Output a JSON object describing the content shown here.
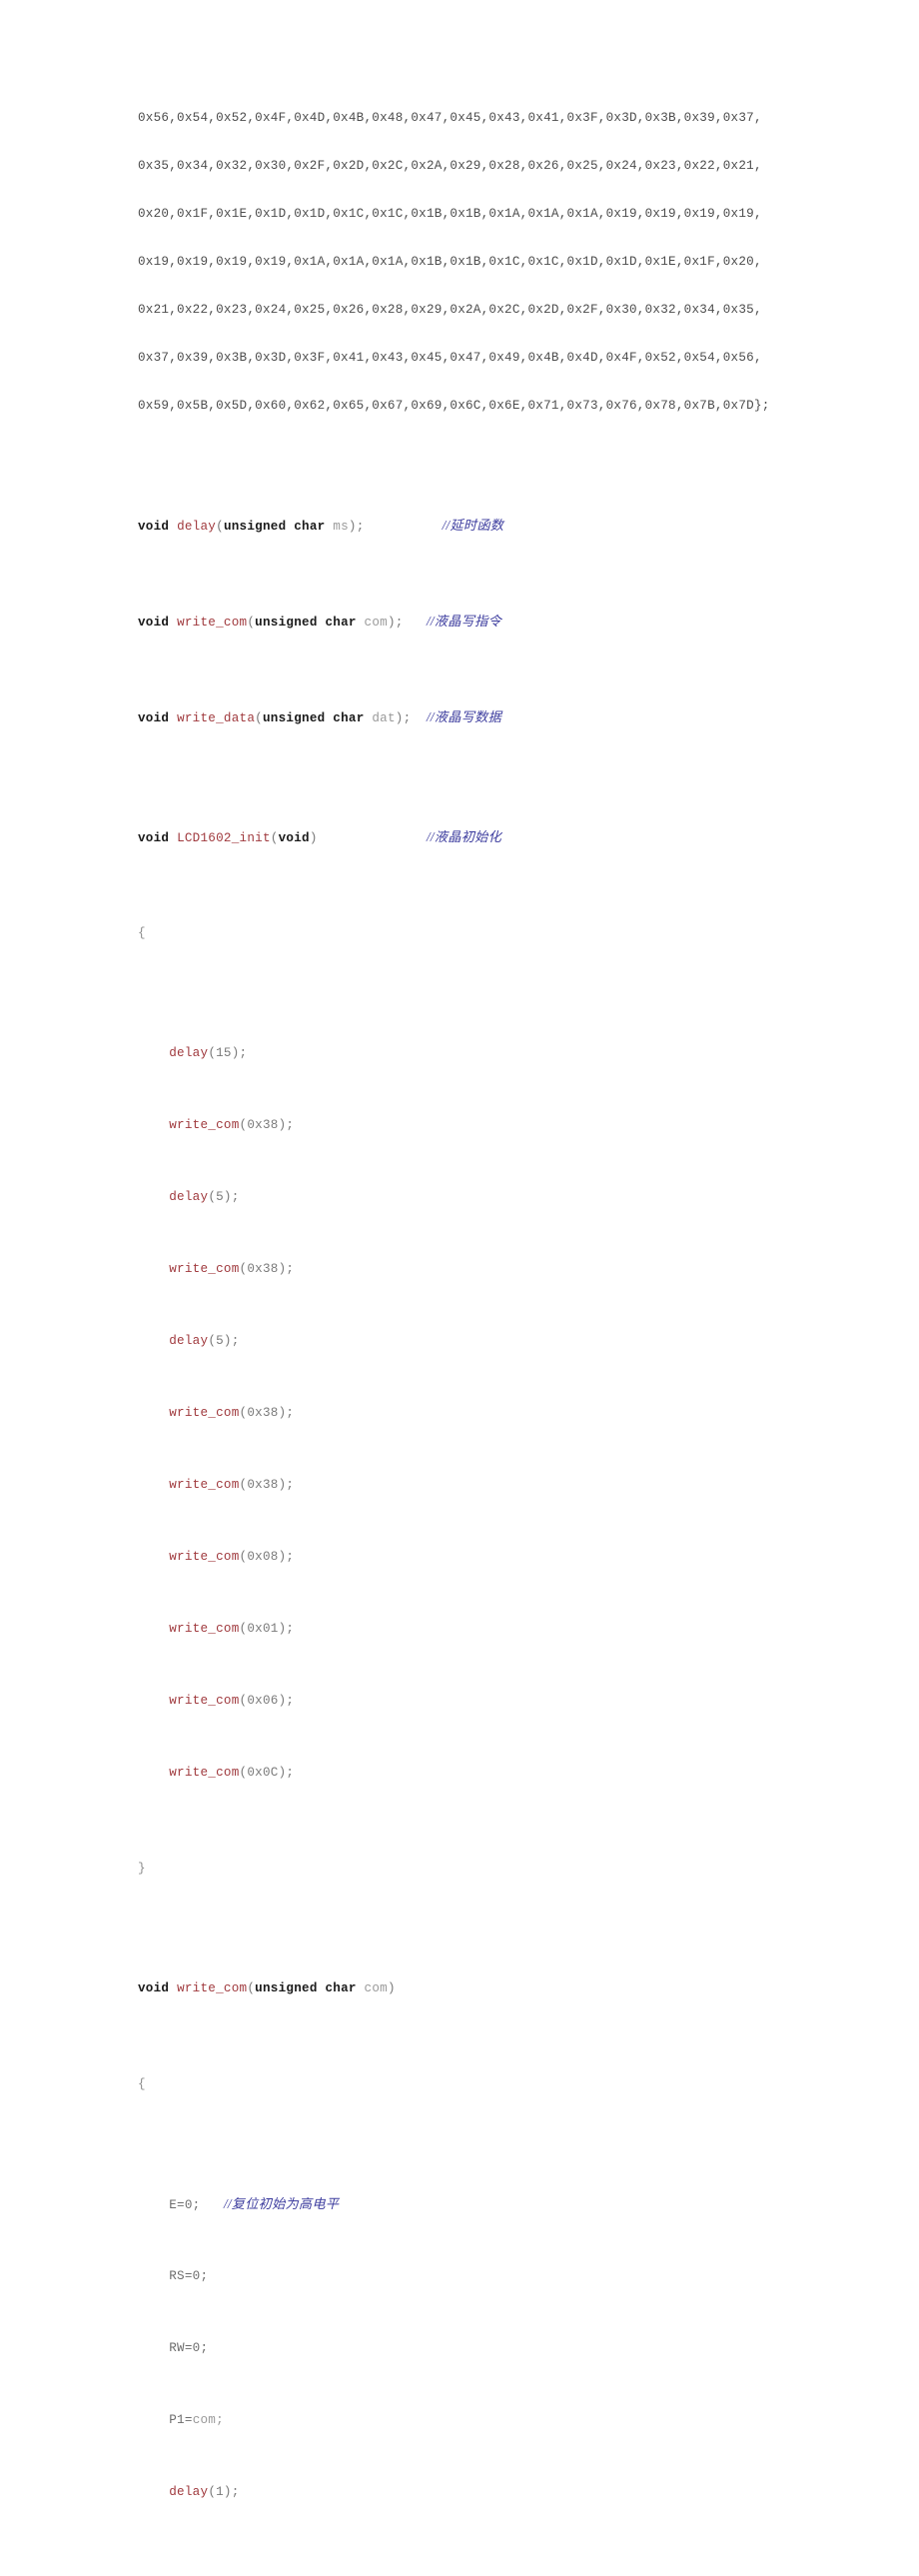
{
  "document": {
    "type": "source-code-listing",
    "language": "C",
    "page_background": "#ffffff",
    "colors": {
      "plain_text": "#4d4d4d",
      "keyword": "#1a1a1a",
      "function_name": "#a03a3e",
      "variable": "#9a9a9a",
      "punctuation": "#7a7a7a",
      "comment": "#3c3c9e"
    }
  },
  "hex_paragraphs": [
    "0x56,0x54,0x52,0x4F,0x4D,0x4B,0x48,0x47,0x45,0x43,0x41,0x3F,0x3D,0x3B,0x39,0x37,",
    "0x35,0x34,0x32,0x30,0x2F,0x2D,0x2C,0x2A,0x29,0x28,0x26,0x25,0x24,0x23,0x22,0x21,",
    "0x20,0x1F,0x1E,0x1D,0x1D,0x1C,0x1C,0x1B,0x1B,0x1A,0x1A,0x1A,0x19,0x19,0x19,0x19,",
    "0x19,0x19,0x19,0x19,0x1A,0x1A,0x1A,0x1B,0x1B,0x1C,0x1C,0x1D,0x1D,0x1E,0x1F,0x20,",
    "0x21,0x22,0x23,0x24,0x25,0x26,0x28,0x29,0x2A,0x2C,0x2D,0x2F,0x30,0x32,0x34,0x35,",
    "0x37,0x39,0x3B,0x3D,0x3F,0x41,0x43,0x45,0x47,0x49,0x4B,0x4D,0x4F,0x52,0x54,0x56,",
    "0x59,0x5B,0x5D,0x60,0x62,0x65,0x67,0x69,0x6C,0x6E,0x71,0x73,0x76,0x78,0x7B,0x7D};"
  ],
  "declarations": [
    {
      "keyword": "void",
      "name": "delay",
      "paren_open": "(",
      "type": "unsigned char",
      "param": "ms",
      "tail": ");",
      "pad": "          ",
      "comment": "//延时函数"
    },
    {
      "keyword": "void",
      "name": "write_com",
      "paren_open": "(",
      "type": "unsigned char",
      "param": "com",
      "tail": ");",
      "pad": "   ",
      "comment": "//液晶写指令"
    },
    {
      "keyword": "void",
      "name": "write_data",
      "paren_open": "(",
      "type": "unsigned char",
      "param": "dat",
      "tail": ");",
      "pad": "  ",
      "comment": "//液晶写数据"
    }
  ],
  "init_function": {
    "keyword": "void",
    "name": "LCD1602_init",
    "signature_tail": "(",
    "void_param": "void",
    "signature_close": ")",
    "pad": "              ",
    "comment": "//液晶初始化",
    "open_brace": "{",
    "close_brace": "}",
    "body": [
      {
        "indent": "    ",
        "fn": "delay",
        "args": "(15);"
      },
      {
        "indent": "    ",
        "fn": "write_com",
        "args": "(0x38);"
      },
      {
        "indent": "    ",
        "fn": "delay",
        "args": "(5);"
      },
      {
        "indent": "    ",
        "fn": "write_com",
        "args": "(0x38);"
      },
      {
        "indent": "    ",
        "fn": "delay",
        "args": "(5);"
      },
      {
        "indent": "    ",
        "fn": "write_com",
        "args": "(0x38);"
      },
      {
        "indent": "    ",
        "fn": "write_com",
        "args": "(0x38);"
      },
      {
        "indent": "    ",
        "fn": "write_com",
        "args": "(0x08);"
      },
      {
        "indent": "    ",
        "fn": "write_com",
        "args": "(0x01);"
      },
      {
        "indent": "    ",
        "fn": "write_com",
        "args": "(0x06);"
      },
      {
        "indent": "    ",
        "fn": "write_com",
        "args": "(0x0C);"
      }
    ]
  },
  "write_com_function": {
    "keyword": "void",
    "name": "write_com",
    "paren_open": "(",
    "type": "unsigned char",
    "param": "com",
    "paren_close": ")",
    "open_brace": "{",
    "body": [
      {
        "indent": "    ",
        "lhs": "E=0;",
        "pad": "   ",
        "comment": "//复位初始为高电平"
      },
      {
        "indent": "    ",
        "lhs": "RS=0;",
        "pad": "",
        "comment": ""
      },
      {
        "indent": "    ",
        "lhs": "RW=0;",
        "pad": "",
        "comment": ""
      },
      {
        "indent": "    ",
        "lhs": "P1=",
        "rhs": "com;",
        "pad": "",
        "comment": ""
      },
      {
        "indent": "    ",
        "fn": "delay",
        "args": "(1);"
      }
    ]
  }
}
